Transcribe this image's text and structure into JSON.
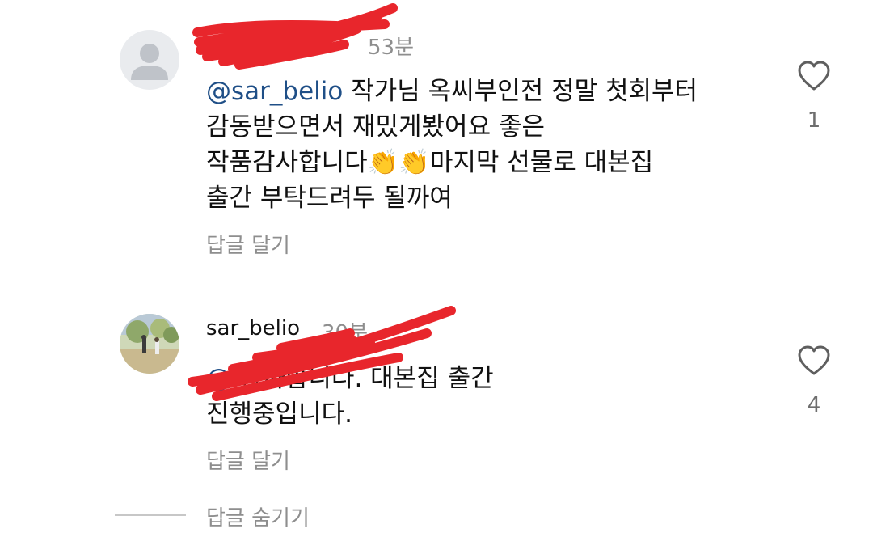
{
  "comments": [
    {
      "username": "",
      "time": "53분",
      "mention": "@sar_belio",
      "text": " 작가님 옥씨부인전 정말 첫회부터\n감동받으면서 재밌게봤어요 좋은\n작품감사합니다👏👏마지막 선물로 대본집\n출간 부탁드려두 될까여",
      "reply_label": "답글 달기",
      "likes": "1",
      "avatar_icon": "default-user-icon"
    },
    {
      "username": "sar_belio",
      "time": "30분",
      "mention": "@",
      "text": " 감사합니다. 대본집 출간\n진행중입니다.",
      "reply_label": "답글 달기",
      "likes": "4",
      "avatar_icon": "profile-photo"
    }
  ],
  "hide_replies_label": "답글 숨기기",
  "colors": {
    "mention": "#1f4f87",
    "meta": "#8e8e8e",
    "redaction": "#e8262c"
  }
}
